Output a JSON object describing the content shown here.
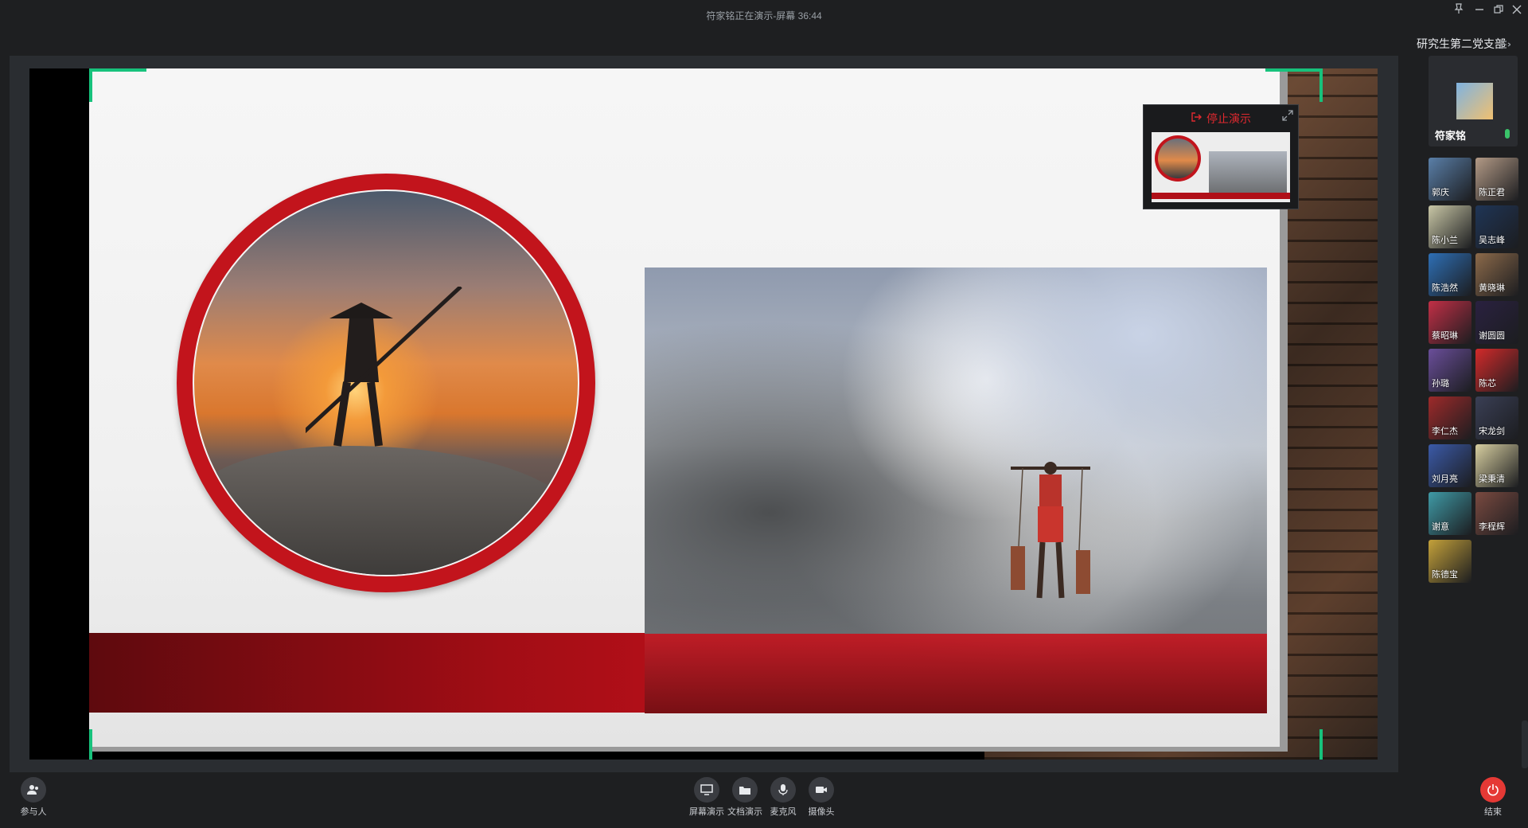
{
  "window": {
    "title": "符家铭正在演示-屏幕 36:44",
    "controls": [
      "pin-icon",
      "minimize-icon",
      "restore-icon",
      "close-icon"
    ]
  },
  "presentation": {
    "stop_label": "停止演示",
    "accent_color": "#17c27c"
  },
  "sidebar": {
    "room_name": "研究生第二党支部",
    "host": {
      "name": "符家铭"
    },
    "participants": [
      {
        "name": "郭庆",
        "color": "#5a7fa8"
      },
      {
        "name": "陈正君",
        "color": "#b39a86"
      },
      {
        "name": "陈小兰",
        "color": "#c9c7a6"
      },
      {
        "name": "吴志峰",
        "color": "#1f3556"
      },
      {
        "name": "陈浩然",
        "color": "#2e6fb5"
      },
      {
        "name": "黄晓琳",
        "color": "#8c6a4a"
      },
      {
        "name": "蔡昭琳",
        "color": "#c22f46"
      },
      {
        "name": "谢圆圆",
        "color": "#2a2140"
      },
      {
        "name": "孙璐",
        "color": "#6a4e9a"
      },
      {
        "name": "陈芯",
        "color": "#d32a2a"
      },
      {
        "name": "李仁杰",
        "color": "#9e2a2a"
      },
      {
        "name": "宋龙剑",
        "color": "#3a3f55"
      },
      {
        "name": "刘月亮",
        "color": "#3b5aa8"
      },
      {
        "name": "梁秉清",
        "color": "#d8cfa0"
      },
      {
        "name": "谢意",
        "color": "#3f9aa6"
      },
      {
        "name": "李程辉",
        "color": "#7a4a40"
      },
      {
        "name": "陈德宝",
        "color": "#c4a13a"
      }
    ]
  },
  "toolbar": {
    "participants_label": "参与人",
    "screen_share_label": "屏幕演示",
    "doc_share_label": "文档演示",
    "mic_label": "麦克风",
    "camera_label": "摄像头",
    "end_label": "结束"
  }
}
